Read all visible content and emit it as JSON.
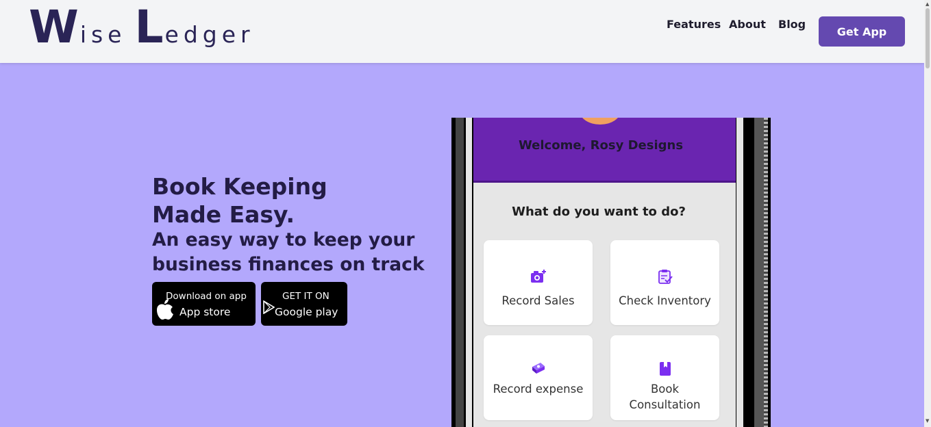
{
  "brand": {
    "w": "W",
    "ise": "ise",
    "l": "L",
    "edger": "edger"
  },
  "nav": {
    "features": "Features",
    "about": "About",
    "blog": "Blog",
    "get_app": "Get App"
  },
  "hero": {
    "title_line1": "Book Keeping",
    "title_line2": "Made Easy.",
    "subtitle": "An easy way to keep your business finances on track"
  },
  "stores": {
    "apple": {
      "line1": "Download on app",
      "line2": "App store"
    },
    "google": {
      "line1": "GET IT ON",
      "line2": "Google play"
    }
  },
  "phone": {
    "welcome": "Welcome, Rosy Designs",
    "question": "What do you want to do?",
    "cards": [
      {
        "label": "Record Sales",
        "icon": "camera-plus-icon"
      },
      {
        "label": "Check Inventory",
        "icon": "clipboard-check-icon"
      },
      {
        "label": "Record expense",
        "icon": "money-stack-icon"
      },
      {
        "label_line1": "Book",
        "label_line2": "Consultation",
        "icon": "book-icon"
      }
    ]
  },
  "colors": {
    "hero_bg": "#b3a8fc",
    "header_bg": "#f3f4f6",
    "brand_text": "#2a2456",
    "button_accent": "#6449b0",
    "app_purple": "#6a25b0",
    "icon_purple": "#7b2ff0"
  }
}
